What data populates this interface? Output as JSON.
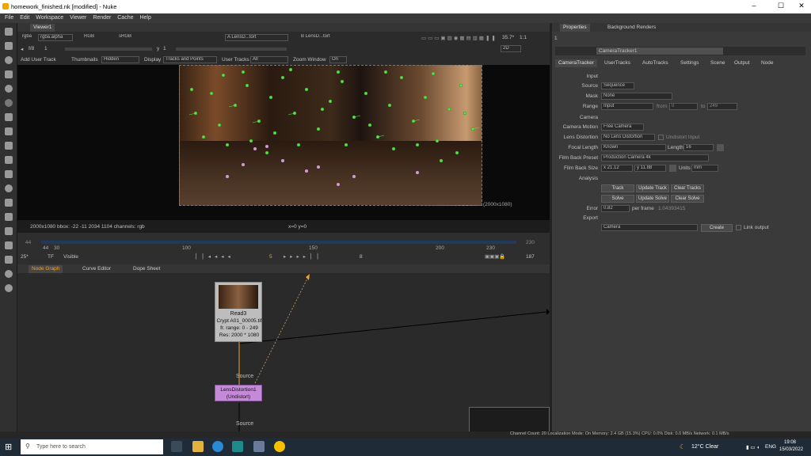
{
  "window": {
    "title": "homework_finished.nk [modified] - Nuke"
  },
  "menu": [
    "File",
    "Edit",
    "Workspace",
    "Viewer",
    "Render",
    "Cache",
    "Help"
  ],
  "viewer": {
    "tab": "Viewer1",
    "channels": "rgba",
    "alpha": "rgba.alpha",
    "colorspace": "RGB",
    "lut": "sRGB",
    "input_a": "A LensD...tort",
    "input_b": "B LensD...tort",
    "fstop": "f/8",
    "frame_inc": "1",
    "ypos": "y",
    "ynum": "1",
    "zoom": "35.7*",
    "ratio": "1:1",
    "mode2d": "2D",
    "options": {
      "add_user_track": "Add User Track",
      "thumbnails_label": "Thumbnails",
      "thumbnails_value": "Hidden",
      "display_label": "Display",
      "display_value": "Tracks and Points",
      "user_tracks_label": "User Tracks",
      "user_tracks_value": "All",
      "zoom_window_label": "Zoom Window",
      "zoom_window_value": "On"
    },
    "format_label": "(2000x1080)",
    "info": "2000x1080  bbox: -22 -11 2034 1104 channels: rgb",
    "coords": "x=0 y=0"
  },
  "timeline": {
    "ticks": [
      "44",
      "30",
      "100",
      "150",
      "200",
      "230"
    ],
    "start": "44",
    "end": "230",
    "fps": "25*",
    "tf": "TF",
    "visible": "Visible",
    "current": "5",
    "step": "8",
    "last": "187"
  },
  "graph": {
    "tabs": [
      "Node Graph",
      "Curve Editor",
      "Dope Sheet"
    ],
    "read_node": {
      "name": "Read3",
      "line1": "Crypt A01_00005.tif",
      "line2": "fr. range: 0 - 249",
      "line3": "Res: 2000 * 1080"
    },
    "lens_node": {
      "name": "LensDistortion1",
      "mode": "(Undistort)"
    },
    "source_label_1": "Source",
    "source_label_2": "Source"
  },
  "properties": {
    "tabs": [
      "Properties",
      "Background Renders"
    ],
    "count": "1",
    "node_name": "CameraTracker1",
    "subtabs": [
      "CameraTracker",
      "UserTracks",
      "AutoTracks",
      "Settings",
      "Scene",
      "Output",
      "Node"
    ],
    "input_section": "Input",
    "source_label": "Source",
    "source_value": "Sequence",
    "mask_label": "Mask",
    "mask_value": "None",
    "range_label": "Range",
    "range_value": "Input",
    "from_label": "from",
    "from_value": "0",
    "to_label": "to",
    "to_value": "249",
    "camera_section": "Camera",
    "motion_label": "Camera Motion",
    "motion_value": "Free Camera",
    "lens_label": "Lens Distortion",
    "lens_value": "No Lens Distortion",
    "undistort_label": "Undistort Input",
    "focal_label": "Focal Length",
    "focal_value": "Known",
    "length_label": "Length",
    "length_value": "16",
    "filmback_label": "Film Back Preset",
    "filmback_value": "Production Camera 4k",
    "filmsize_label": "Film Back Size",
    "filmsize_x": "x 21.12",
    "filmsize_y": "y 11.88",
    "units_label": "Units",
    "units_value": "mm",
    "analysis_section": "Analysis",
    "track_btn": "Track",
    "update_track_btn": "Update Track",
    "clear_tracks_btn": "Clear Tracks",
    "solve_btn": "Solve",
    "update_solve_btn": "Update Solve",
    "clear_solve_btn": "Clear Solve",
    "error_label": "Error",
    "error_value": "0.82",
    "per_frame_label": "per frame",
    "per_frame_value": "1.04393415",
    "export_section": "Export",
    "export_value": "Camera",
    "create_btn": "Create",
    "link_output_label": "Link output"
  },
  "status_bar": "Channel Count: 20  Localization Mode: On  Memory: 2.4 GB (15.3%)  CPU: 0.0%  Disk: 0.0 MB/s  Network: 0.1 MB/s",
  "taskbar": {
    "search_placeholder": "Type here to search",
    "weather": "12°C  Clear",
    "lang": "ENG",
    "time": "19:08",
    "date": "15/03/2022"
  }
}
